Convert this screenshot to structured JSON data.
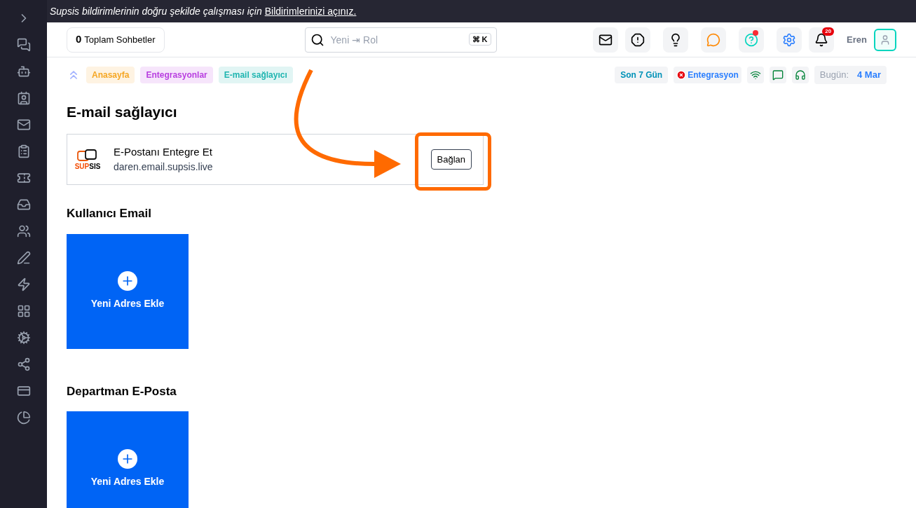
{
  "banner": {
    "text": "Supsis bildirimlerinin doğru şekilde çalışması için",
    "link": "Bildirimlerinizi açınız."
  },
  "header": {
    "chat_count": "0",
    "chat_label": "Toplam Sohbetler",
    "search": {
      "placeholder": "Yeni ⇥ Rol",
      "shortcut": "⌘ K"
    },
    "tools": [
      {
        "dot": false
      },
      {
        "dot": false
      },
      {
        "dot": false
      },
      {
        "dot": false
      },
      {
        "dot": true
      },
      {
        "dot": false
      },
      {
        "dot": false,
        "badge": "20"
      }
    ],
    "user": "Eren"
  },
  "breadcrumbs": [
    {
      "label": "Anasayfa",
      "color": "#f5a623"
    },
    {
      "label": "Entegrasyonlar",
      "color": "#b83fe0"
    },
    {
      "label": "E-mail sağlayıcı",
      "color": "#1fb5b0"
    }
  ],
  "status": {
    "period": "Son 7 Gün",
    "integration": "Entegrasyon",
    "today_label": "Bugün:",
    "today_value": "4 Mar"
  },
  "page_title": "E-mail sağlayıcı",
  "provider": {
    "logo_a": "SUP",
    "logo_b": "SIS",
    "title": "E-Postanı Entegre Et",
    "address": "daren.email.supsis.live",
    "button": "Bağlan"
  },
  "sections": [
    {
      "title": "Kullanıcı Email",
      "add_label": "Yeni Adres Ekle"
    },
    {
      "title": "Departman E-Posta",
      "add_label": "Yeni Adres Ekle"
    }
  ]
}
